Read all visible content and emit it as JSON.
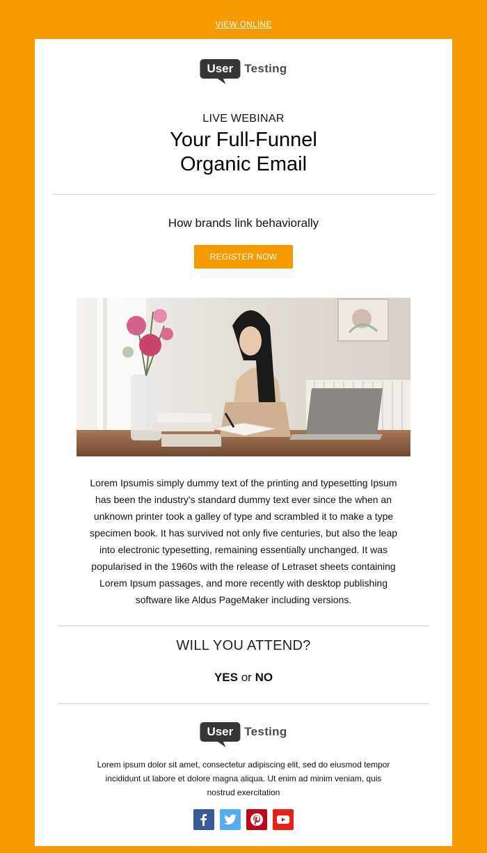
{
  "header": {
    "view_online": "VIEW ONLINE"
  },
  "brand": {
    "part1": "User",
    "part2": "Testing"
  },
  "hero": {
    "eyebrow": "LIVE WEBINAR",
    "title_line1": "Your Full-Funnel",
    "title_line2": "Organic Email",
    "subtitle": "How brands link behaviorally",
    "cta_label": "REGISTER NOW"
  },
  "body": {
    "paragraph": "Lorem Ipsumis simply dummy text of the printing and typesetting Ipsum has been the industry's standard dummy text ever since the when an unknown printer took a galley of type and scrambled it to make a type specimen book. It has survived not only five centuries, but also the leap into electronic typesetting, remaining essentially unchanged. It was popularised in the 1960s with the release of Letraset sheets containing Lorem Ipsum passages, and more recently with desktop publishing software like Aldus PageMaker including versions."
  },
  "rsvp": {
    "question": "WILL YOU ATTEND?",
    "yes": "YES",
    "or": "or",
    "no": "NO"
  },
  "footer": {
    "text": "Lorem ipsum dolor sit amet, consectetur adipiscing elit, sed do eiusmod tempor incididunt ut labore et dolore magna aliqua. Ut enim ad minim veniam, quis nostrud exercitation",
    "socials": [
      {
        "icon": "facebook-icon",
        "color": "#3b5998"
      },
      {
        "icon": "twitter-icon",
        "color": "#55acee"
      },
      {
        "icon": "pinterest-icon",
        "color": "#bd081c"
      },
      {
        "icon": "youtube-icon",
        "color": "#e62117"
      }
    ]
  },
  "colors": {
    "accent": "#f59a00",
    "logo_dark": "#363636"
  }
}
